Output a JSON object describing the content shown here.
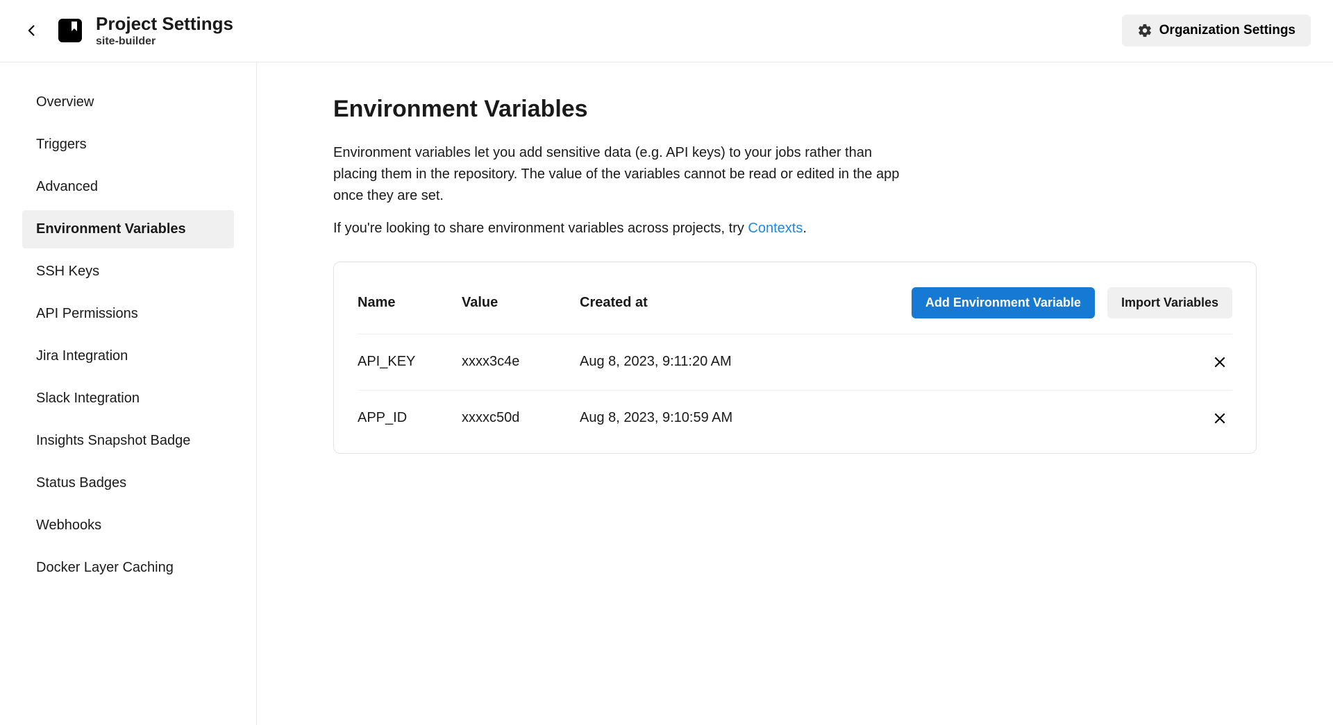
{
  "header": {
    "title": "Project Settings",
    "project_name": "site-builder",
    "org_settings_label": "Organization Settings"
  },
  "sidebar": {
    "items": [
      {
        "label": "Overview",
        "active": false
      },
      {
        "label": "Triggers",
        "active": false
      },
      {
        "label": "Advanced",
        "active": false
      },
      {
        "label": "Environment Variables",
        "active": true
      },
      {
        "label": "SSH Keys",
        "active": false
      },
      {
        "label": "API Permissions",
        "active": false
      },
      {
        "label": "Jira Integration",
        "active": false
      },
      {
        "label": "Slack Integration",
        "active": false
      },
      {
        "label": "Insights Snapshot Badge",
        "active": false
      },
      {
        "label": "Status Badges",
        "active": false
      },
      {
        "label": "Webhooks",
        "active": false
      },
      {
        "label": "Docker Layer Caching",
        "active": false
      }
    ]
  },
  "main": {
    "heading": "Environment Variables",
    "description": "Environment variables let you add sensitive data (e.g. API keys) to your jobs rather than placing them in the repository. The value of the variables cannot be read or edited in the app once they are set.",
    "share_prefix": "If you're looking to share environment variables across projects, try ",
    "share_link_text": "Contexts",
    "share_suffix": ".",
    "table": {
      "col_name": "Name",
      "col_value": "Value",
      "col_created": "Created at",
      "add_label": "Add Environment Variable",
      "import_label": "Import Variables",
      "rows": [
        {
          "name": "API_KEY",
          "value": "xxxx3c4e",
          "created": "Aug 8, 2023, 9:11:20 AM"
        },
        {
          "name": "APP_ID",
          "value": "xxxxc50d",
          "created": "Aug 8, 2023, 9:10:59 AM"
        }
      ]
    }
  }
}
